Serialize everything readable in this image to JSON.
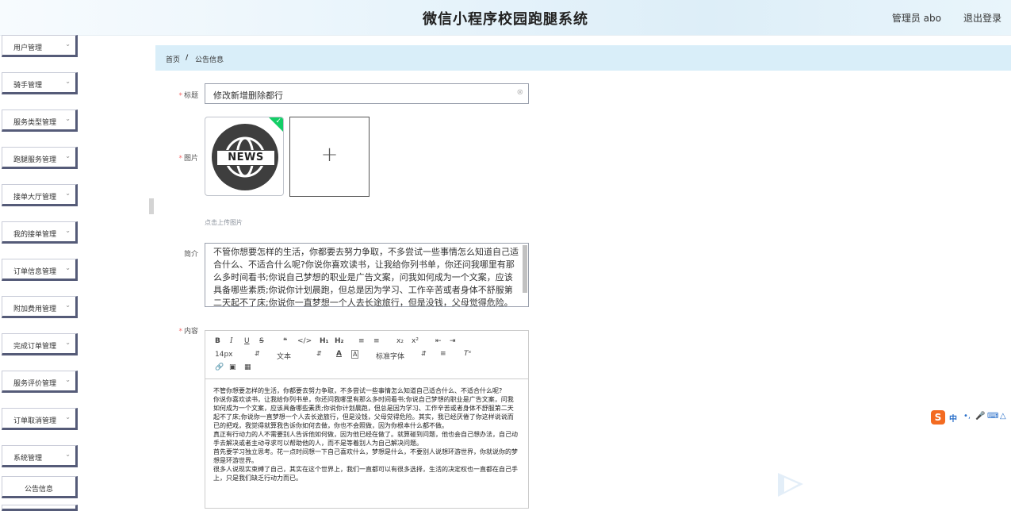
{
  "header": {
    "title": "微信小程序校园跑腿系统",
    "user": "管理员 abo",
    "logout": "退出登录"
  },
  "sidebar": {
    "items": [
      {
        "label": "用户管理"
      },
      {
        "label": "骑手管理"
      },
      {
        "label": "服务类型管理"
      },
      {
        "label": "跑腿服务管理"
      },
      {
        "label": "接单大厅管理"
      },
      {
        "label": "我的接单管理"
      },
      {
        "label": "订单信息管理"
      },
      {
        "label": "附加费用管理"
      },
      {
        "label": "完成订单管理"
      },
      {
        "label": "服务评价管理"
      },
      {
        "label": "订单取消管理"
      },
      {
        "label": "系统管理"
      }
    ],
    "sub_item": "公告信息"
  },
  "breadcrumb": {
    "home": "首页",
    "separator": "/",
    "current": "公告信息"
  },
  "form": {
    "title_label": "标题",
    "title_value": "修改新增删除都行",
    "image_label": "图片",
    "image_badge_text": "NEWS",
    "upload_hint": "点击上传图片",
    "intro_label": "简介",
    "intro_value": "不管你想要怎样的生活，你都要去努力争取，不多尝试一些事情怎么知道自己适合什么、不适合什么呢?你说你喜欢读书，让我给你列书单，你还问我哪里有那么多时间看书;你说自己梦想的职业是广告文案，问我如何成为一个文案，应该具备哪些素质;你说你计划晨跑，但总是因为学习、工作辛苦或者身体不舒服第二天起不了床;你说你一直梦想一个人去长途旅行，但是没钱，父母觉得危险。",
    "content_label": "内容"
  },
  "editor": {
    "font_size": "14px",
    "block_format": "文本",
    "font_family": "标准字体",
    "paragraphs": [
      "不管你想要怎样的生活，你都要去努力争取，不多尝试一些事情怎么知道自己适合什么、不适合什么呢?",
      "你说你喜欢读书，让我给你列书单，你还问我哪里有那么多时间看书;你说自己梦想的职业是广告文案，问我如何成为一个文案，应该具备哪些素质;你说你计划晨跑，但总是因为学习、工作辛苦或者身体不舒服第二天起不了床;你说你一直梦想一个人去长途旅行，但是没钱，父母觉得危险。其实，我已经厌倦了你这样说说而已的把戏，我觉得就算我告诉你如何去做，你也不会照做，因为你根本什么都不做。",
      "真正有行动力的人不需要别人告诉他如何做，因为他已经在做了。就算碰到问题，他也会自己想办法，自己动手去解决或者主动寻求可以帮助他的人，而不是等着别人为自己解决问题。",
      "首先要学习独立思考。花一点时间想一下自己喜欢什么，梦想是什么，不要别人说想环游世界，你就说你的梦想是环游世界。",
      "很多人说现实束缚了自己，其实在这个世界上，我们一直都可以有很多选择，生活的决定权也一直都在自己手上，只是我们缺乏行动力而已。"
    ]
  },
  "ime": {
    "logo": "S",
    "mode": "中"
  },
  "colors": {
    "header_bg": "#e8f4fb",
    "breadcrumb_bg": "#d9eef9",
    "menu_border": "#555b78",
    "required": "#f56c6c",
    "check_badge": "#13ce66"
  }
}
